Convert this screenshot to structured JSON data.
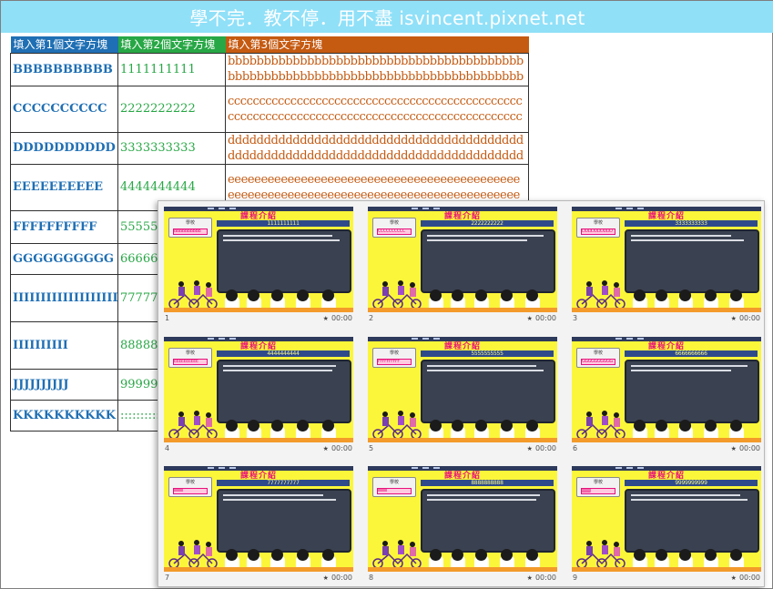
{
  "banner": {
    "text": "學不完．教不停．用不盡 isvincent.pixnet.net"
  },
  "sheet": {
    "headers": [
      "填入第1個文字方塊",
      "填入第2個文字方塊",
      "填入第3個文字方塊"
    ],
    "rows": [
      {
        "col1": "BBBBBBBBBB",
        "col2": "1111111111",
        "col3": "bbbbbbbbbbbbbbbbbbbbbbbbbbbbbbbbbbbbbbbbbbbbbbbbbbbbbbbbbbbbbbbbbbbbbbbbbbbbbbbbbbbbbbbbb"
      },
      {
        "col1": "CCCCCCCCCC",
        "col2": "2222222222",
        "col3": "ccccccccccccccccccccccccccccccccccccccccccccccccccccccccccccccccccccccccccccccccccccccccccccccccccccc"
      },
      {
        "col1": "DDDDDDDDDD",
        "col2": "3333333333",
        "col3": "dddddddddddddddddddddddddddddddddddddddddddddddddddddddddddddddddddddddddddddddddddddddddddd"
      },
      {
        "col1": "EEEEEEEEEE",
        "col2": "4444444444",
        "col3": "eeeeeeeeeeeeeeeeeeeeeeeeeeeeeeeeeeeeeeeeeeeeeeeeeeeeeeeeeeeeeeeeeeeeeeeeeeeeeeeeeeeeeeeeeeeeeeeeeeeeee"
      },
      {
        "col1": "FFFFFFFFFF",
        "col2": "555555",
        "col3": ""
      },
      {
        "col1": "GGGGGGGGGG",
        "col2": "666666",
        "col3": ""
      },
      {
        "col1": "IIIIIIIIIIIIIIIIIIII",
        "col2": "777777",
        "col3": ""
      },
      {
        "col1": "IIIIIIIIII",
        "col2": "888888",
        "col3": ""
      },
      {
        "col1": "JJJJJJJJJJ",
        "col2": "999999",
        "col3": ""
      },
      {
        "col1": "KKKKKKKKKK",
        "col2": "::::::::::",
        "col3": ""
      }
    ]
  },
  "slides": {
    "title": "課程介紹",
    "badge_label": "學校",
    "time": "00:00",
    "items": [
      {
        "number": "1",
        "pink": "BBBBBBBBBB",
        "strip": "1111111111"
      },
      {
        "number": "2",
        "pink": "CCCCCCCCCC",
        "strip": "2222222222"
      },
      {
        "number": "3",
        "pink": "DDDDDDDDDD",
        "strip": "3333333333"
      },
      {
        "number": "4",
        "pink": "EEEEEEEEEE",
        "strip": "4444444444"
      },
      {
        "number": "5",
        "pink": "FFFFFFFFFF",
        "strip": "5555555555"
      },
      {
        "number": "6",
        "pink": "GGGGGGGGGG",
        "strip": "6666666666"
      },
      {
        "number": "7",
        "pink": "IIIIIIIIII",
        "strip": "7777777777"
      },
      {
        "number": "8",
        "pink": "IIIIIIIIII",
        "strip": "8888888888"
      },
      {
        "number": "9",
        "pink": "JJJJJJJJJJ",
        "strip": "9999999999"
      }
    ]
  },
  "colors": {
    "banner_bg": "#90e0f8",
    "header1": "#1f6fb4",
    "header2": "#27a745",
    "header3": "#c55a11",
    "slide_bg": "#fcf63a",
    "slide_title": "#e8117a"
  },
  "icons": {
    "slide_time": "star-icon"
  }
}
